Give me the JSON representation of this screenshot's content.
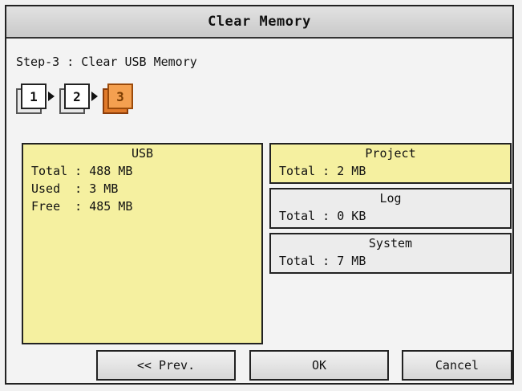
{
  "window": {
    "title": "Clear Memory"
  },
  "step_label": "Step-3 : Clear USB Memory",
  "steps": [
    {
      "number": "1",
      "active": false
    },
    {
      "number": "2",
      "active": false
    },
    {
      "number": "3",
      "active": true
    }
  ],
  "usb": {
    "heading": "USB",
    "lines": [
      "Total : 488 MB",
      "Used  : 3 MB",
      "Free  : 485 MB"
    ]
  },
  "project": {
    "heading": "Project",
    "total": "Total : 2 MB"
  },
  "log": {
    "heading": "Log",
    "total": "Total : 0 KB"
  },
  "system": {
    "heading": "System",
    "total": "Total : 7 MB"
  },
  "buttons": {
    "prev": "<< Prev.",
    "ok": "OK",
    "cancel": "Cancel"
  },
  "colors": {
    "panel_yellow": "#f5f0a0",
    "active_step": "#f4a050",
    "panel_grey": "#ececec"
  }
}
